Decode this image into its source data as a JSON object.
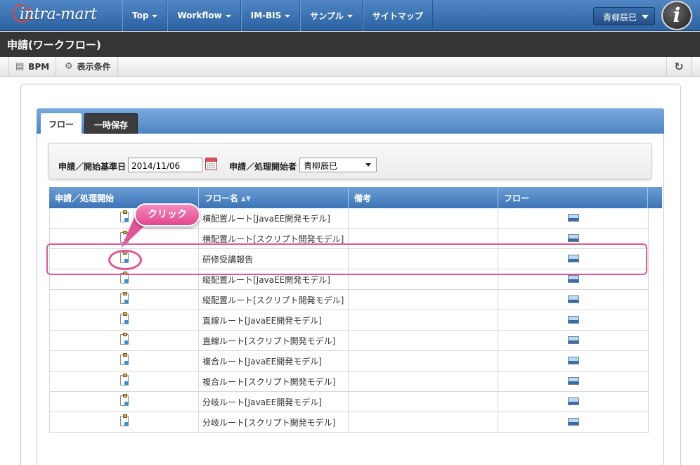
{
  "nav": {
    "logo_text": "intra-mart",
    "items": [
      {
        "label": "Top",
        "has_dropdown": true
      },
      {
        "label": "Workflow",
        "has_dropdown": true
      },
      {
        "label": "IM-BIS",
        "has_dropdown": true
      },
      {
        "label": "サンプル",
        "has_dropdown": true
      },
      {
        "label": "サイトマップ",
        "has_dropdown": false
      }
    ],
    "user_name": "青柳辰巳",
    "info_logo": "i"
  },
  "page_title": "申請(ワークフロー)",
  "toolbar": {
    "bpm_label": "BPM",
    "conditions_label": "表示条件",
    "bpm_icon": "list-icon",
    "conditions_icon": "gear-icon",
    "refresh_icon": "refresh-icon",
    "refresh_glyph": "↻"
  },
  "tabs": [
    {
      "label": "フロー",
      "active": true
    },
    {
      "label": "一時保存",
      "active": false
    }
  ],
  "search": {
    "date_label": "申請／開始基準日",
    "date_value": "2014/11/06",
    "user_label": "申請／処理開始者",
    "user_value": "青柳辰巳"
  },
  "table": {
    "columns": [
      "申請／処理開始",
      "フロー名",
      "備考",
      "フロー"
    ],
    "sort_glyph": "▲▼",
    "rows": [
      {
        "flow_name": "横配置ルート[JavaEE開発モデル]",
        "note": ""
      },
      {
        "flow_name": "横配置ルート[スクリプト開発モデル]",
        "note": ""
      },
      {
        "flow_name": "研修受講報告",
        "note": ""
      },
      {
        "flow_name": "縦配置ルート[JavaEE開発モデル]",
        "note": ""
      },
      {
        "flow_name": "縦配置ルート[スクリプト開発モデル]",
        "note": ""
      },
      {
        "flow_name": "直線ルート[JavaEE開発モデル]",
        "note": ""
      },
      {
        "flow_name": "直線ルート[スクリプト開発モデル]",
        "note": ""
      },
      {
        "flow_name": "複合ルート[JavaEE開発モデル]",
        "note": ""
      },
      {
        "flow_name": "複合ルート[スクリプト開発モデル]",
        "note": ""
      },
      {
        "flow_name": "分岐ルート[JavaEE開発モデル]",
        "note": ""
      },
      {
        "flow_name": "分岐ルート[スクリプト開発モデル]",
        "note": ""
      }
    ]
  },
  "callout": {
    "label": "クリック",
    "color": "#e2559a"
  },
  "colors": {
    "nav_blue": "#3a6fae",
    "title_bar": "#353535",
    "header_blue": "#4f85c3"
  }
}
